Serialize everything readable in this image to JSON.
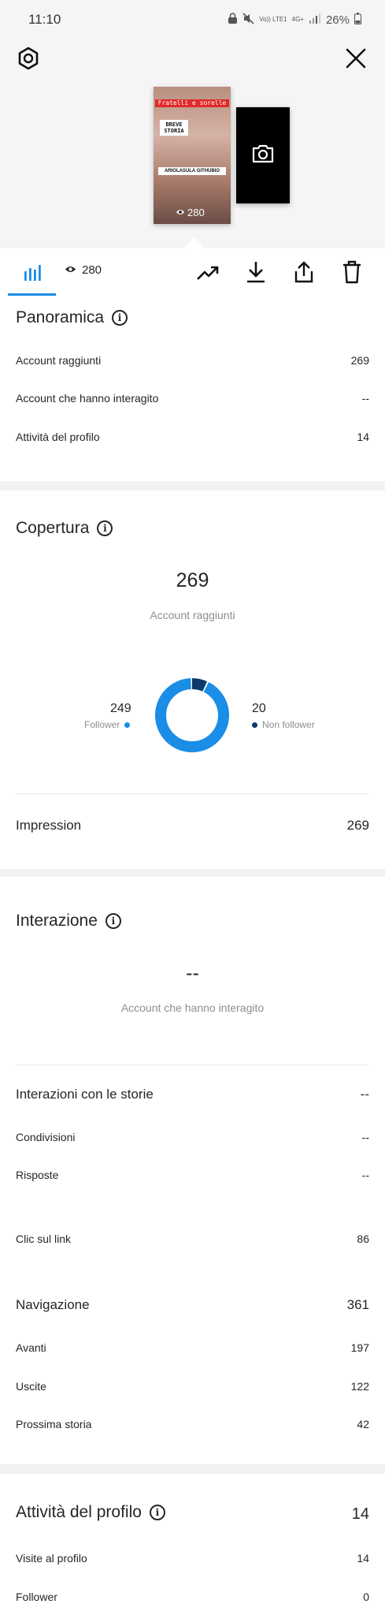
{
  "status_bar": {
    "time": "11:10",
    "network_label": "Vo)) LTE1",
    "network_type": "4G+",
    "battery": "26%"
  },
  "story": {
    "banner_text": "Fratelli e sorelle",
    "title_text": "BREVE STORIA",
    "caption_text": "ARIOLASULA GITHUBIO",
    "views": "280"
  },
  "tabs": {
    "views": "280"
  },
  "panoramica": {
    "title": "Panoramica",
    "rows": [
      {
        "label": "Account raggiunti",
        "value": "269"
      },
      {
        "label": "Account che hanno interagito",
        "value": "--"
      },
      {
        "label": "Attività del profilo",
        "value": "14"
      }
    ]
  },
  "copertura": {
    "title": "Copertura",
    "big_value": "269",
    "big_label": "Account raggiunti",
    "followers_value": "249",
    "followers_label": "Follower",
    "non_followers_value": "20",
    "non_followers_label": "Non follower",
    "followers_share": 0.926,
    "impression_label": "Impression",
    "impression_value": "269",
    "colors": {
      "followers": "#1a8de6",
      "non_followers": "#0d3a6b"
    }
  },
  "interazione": {
    "title": "Interazione",
    "big_value": "--",
    "big_label": "Account che hanno interagito",
    "stories_label": "Interazioni con le storie",
    "stories_value": "--",
    "rows": [
      {
        "label": "Condivisioni",
        "value": "--"
      },
      {
        "label": "Risposte",
        "value": "--"
      }
    ],
    "link_label": "Clic sul link",
    "link_value": "86",
    "nav_label": "Navigazione",
    "nav_value": "361",
    "nav_rows": [
      {
        "label": "Avanti",
        "value": "197"
      },
      {
        "label": "Uscite",
        "value": "122"
      },
      {
        "label": "Prossima storia",
        "value": "42"
      }
    ]
  },
  "profilo": {
    "title": "Attività del profilo",
    "value": "14",
    "rows": [
      {
        "label": "Visite al profilo",
        "value": "14"
      },
      {
        "label": "Follower",
        "value": "0"
      }
    ]
  }
}
